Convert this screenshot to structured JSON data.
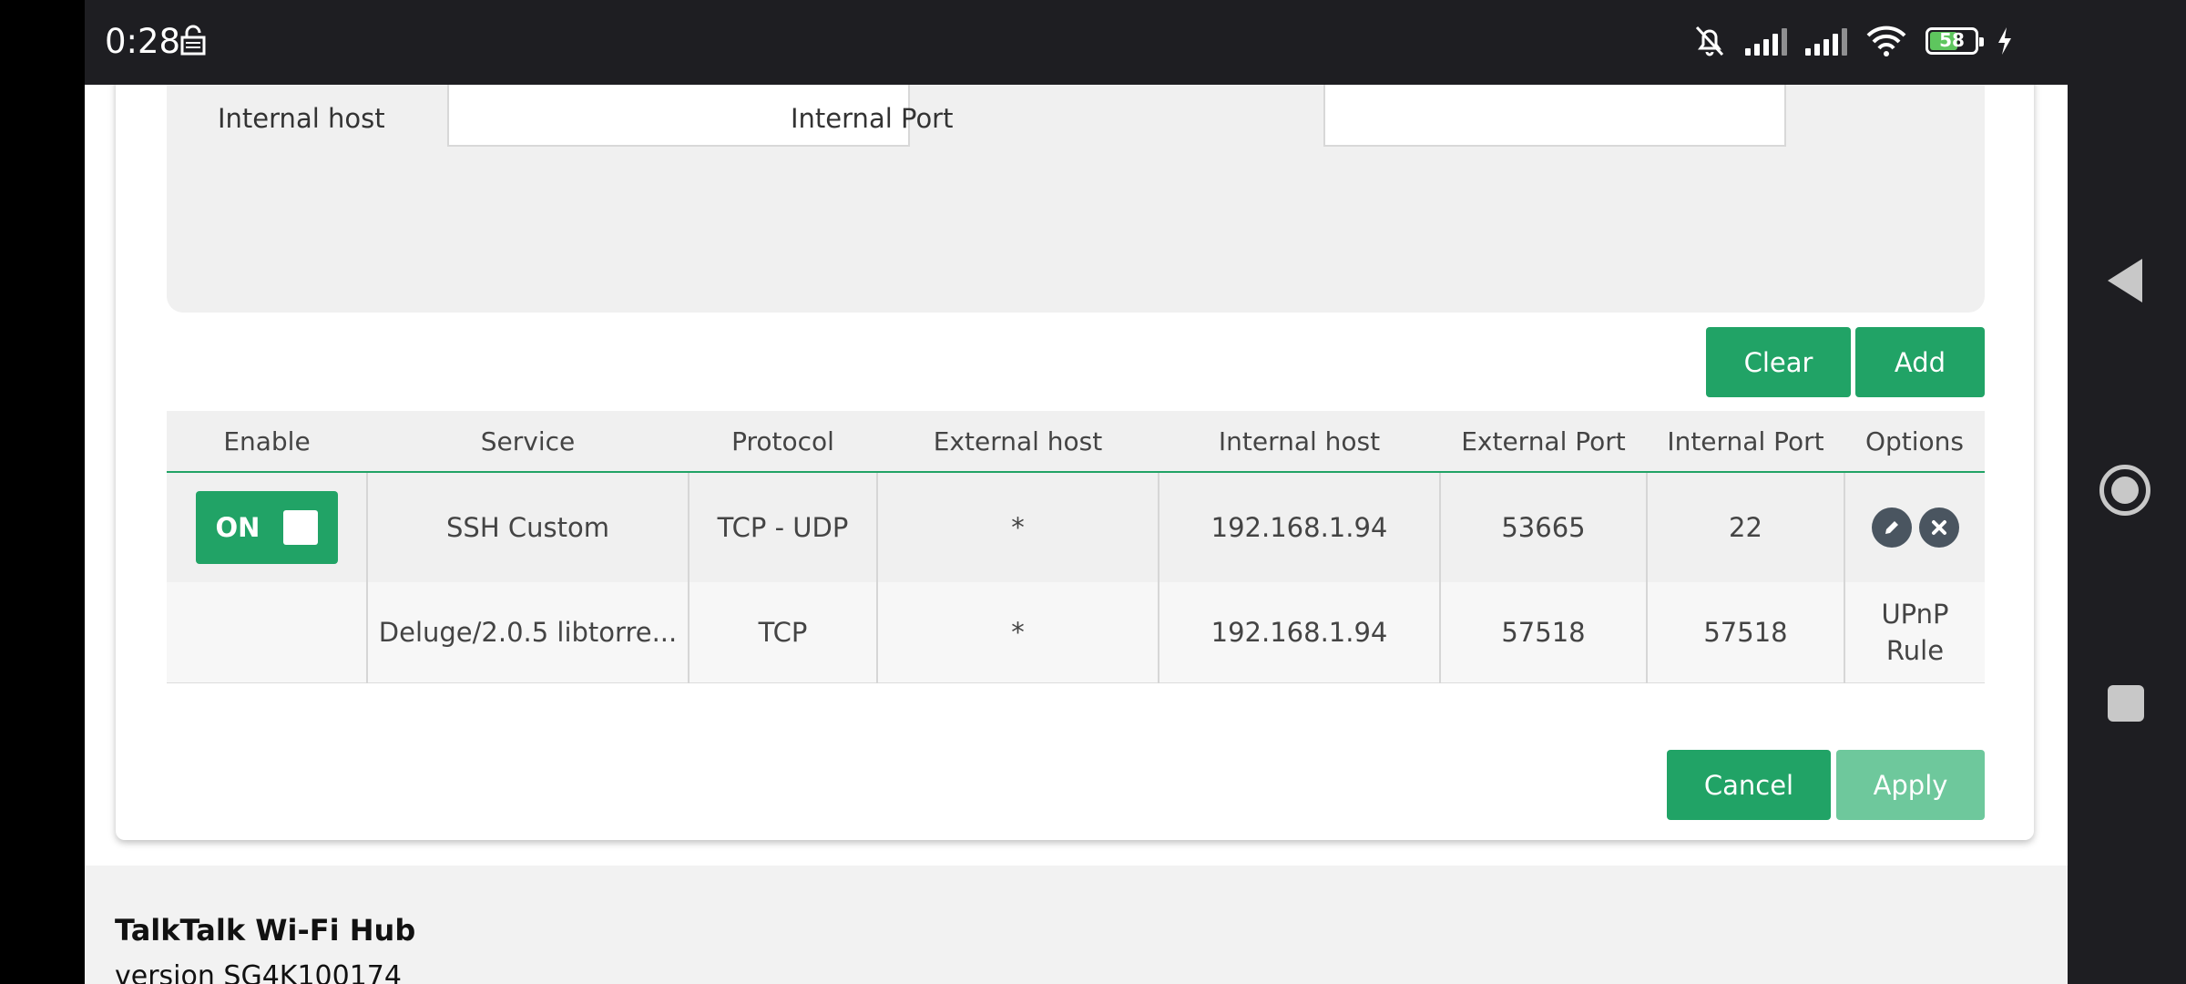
{
  "status_bar": {
    "time": "0:28",
    "battery": "58"
  },
  "form": {
    "internal_host_label": "Internal host",
    "internal_port_label": "Internal Port",
    "internal_host_value": "",
    "internal_port_value": ""
  },
  "buttons": {
    "clear": "Clear",
    "add": "Add",
    "cancel": "Cancel",
    "apply": "Apply"
  },
  "table": {
    "headers": [
      "Enable",
      "Service",
      "Protocol",
      "External host",
      "Internal host",
      "External Port",
      "Internal Port",
      "Options"
    ],
    "rows": [
      {
        "enable": "ON",
        "service": "SSH Custom",
        "protocol": "TCP - UDP",
        "external_host": "*",
        "internal_host": "192.168.1.94",
        "external_port": "53665",
        "internal_port": "22"
      },
      {
        "enable": "",
        "service": "Deluge/2.0.5 libtorre...",
        "protocol": "TCP",
        "external_host": "*",
        "internal_host": "192.168.1.94",
        "external_port": "57518",
        "internal_port": "57518",
        "options_line1": "UPnP",
        "options_line2": "Rule"
      }
    ]
  },
  "footer": {
    "title": "TalkTalk Wi-Fi Hub",
    "version": "version SG4K100174"
  },
  "colors": {
    "accent": "#21a366",
    "accent_disabled": "#6ec89c"
  }
}
